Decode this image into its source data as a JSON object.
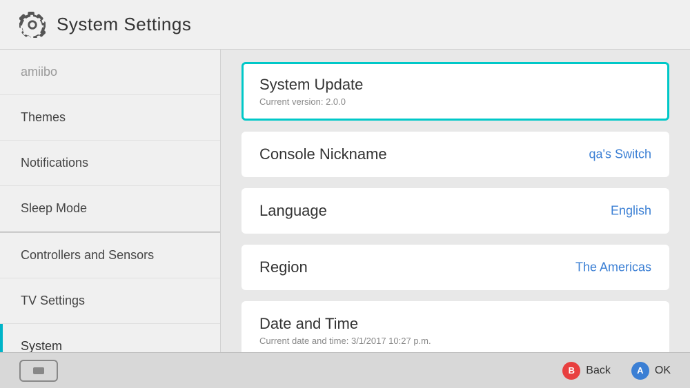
{
  "header": {
    "title": "System Settings"
  },
  "sidebar": {
    "items": [
      {
        "id": "amiibo",
        "label": "amiibo",
        "state": "faded"
      },
      {
        "id": "themes",
        "label": "Themes",
        "state": "normal"
      },
      {
        "id": "notifications",
        "label": "Notifications",
        "state": "normal"
      },
      {
        "id": "sleep-mode",
        "label": "Sleep Mode",
        "state": "normal"
      },
      {
        "id": "controllers-and-sensors",
        "label": "Controllers and Sensors",
        "state": "divider-above"
      },
      {
        "id": "tv-settings",
        "label": "TV Settings",
        "state": "normal"
      },
      {
        "id": "system",
        "label": "System",
        "state": "active"
      }
    ]
  },
  "content": {
    "items": [
      {
        "id": "system-update",
        "title": "System Update",
        "subtitle": "Current version: 2.0.0",
        "value": null,
        "selected": true
      },
      {
        "id": "console-nickname",
        "title": "Console Nickname",
        "subtitle": null,
        "value": "qa's Switch",
        "selected": false
      },
      {
        "id": "language",
        "title": "Language",
        "subtitle": null,
        "value": "English",
        "selected": false
      },
      {
        "id": "region",
        "title": "Region",
        "subtitle": null,
        "value": "The Americas",
        "selected": false
      },
      {
        "id": "date-and-time",
        "title": "Date and Time",
        "subtitle": "Current date and time: 3/1/2017 10:27 p.m.",
        "value": null,
        "selected": false
      }
    ]
  },
  "footer": {
    "back_label": "Back",
    "ok_label": "OK",
    "back_btn": "B",
    "ok_btn": "A"
  }
}
